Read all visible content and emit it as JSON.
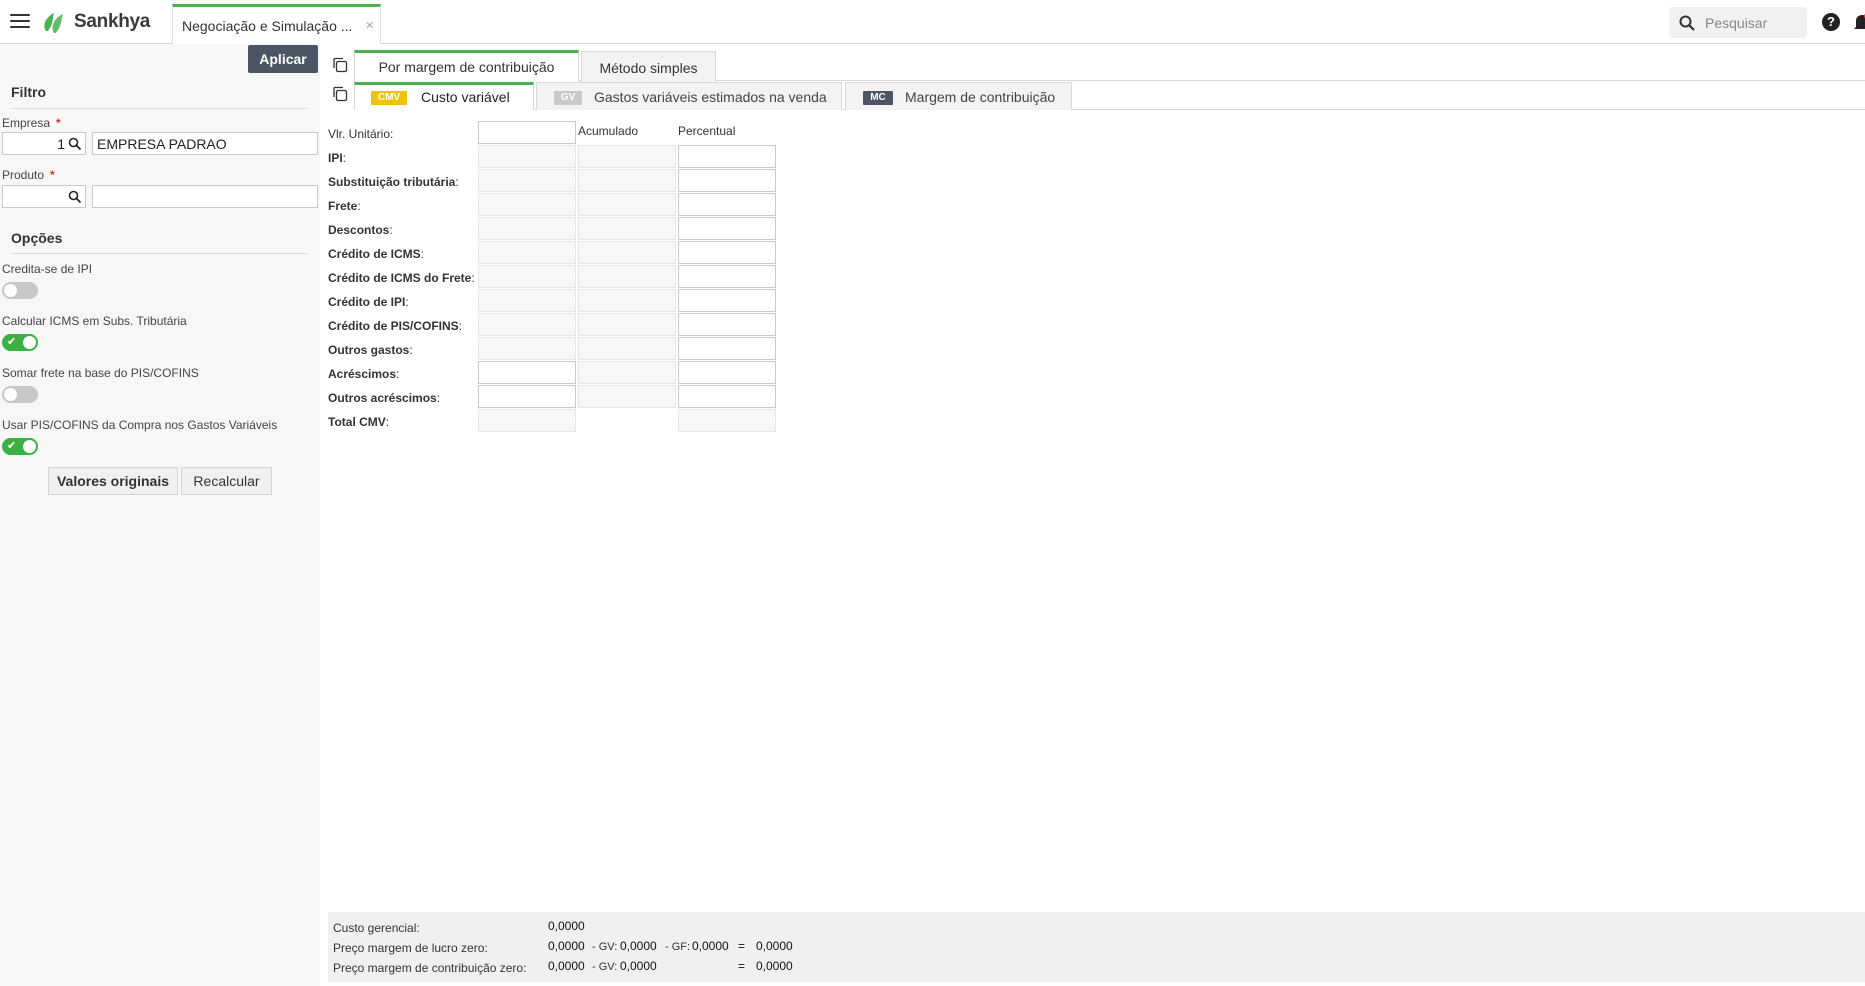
{
  "header": {
    "brand": "Sankhya",
    "open_tab": "Negociação e Simulação ...",
    "close_glyph": "×",
    "search_placeholder": "Pesquisar",
    "help_glyph": "?"
  },
  "filter": {
    "apply_label": "Aplicar",
    "title": "Filtro",
    "empresa_label": "Empresa",
    "empresa_code": "1",
    "empresa_name": "EMPRESA PADRAO",
    "produto_label": "Produto",
    "produto_code": "",
    "produto_name": "",
    "required_mark": "*"
  },
  "options": {
    "title": "Opções",
    "items": [
      {
        "label": "Credita-se de IPI",
        "on": false
      },
      {
        "label": "Calcular ICMS em Subs. Tributária",
        "on": true
      },
      {
        "label": "Somar frete na base do PIS/COFINS",
        "on": false
      },
      {
        "label": "Usar PIS/COFINS da Compra nos Gastos Variáveis",
        "on": true
      }
    ],
    "btn_original": "Valores originais",
    "btn_recalc": "Recalcular"
  },
  "main_tabs": [
    {
      "label": "Por margem de contribuição",
      "active": true
    },
    {
      "label": "Método simples",
      "active": false
    }
  ],
  "sub_tabs": [
    {
      "badge": "CMV",
      "badge_color": "#f2c00f",
      "label": "Custo variável",
      "active": true
    },
    {
      "badge": "GV",
      "badge_color": "#c9c9c9",
      "label": "Gastos variáveis estimados na venda",
      "active": false
    },
    {
      "badge": "MC",
      "badge_color": "#4b5563",
      "label": "Margem de contribuição",
      "active": false
    }
  ],
  "grid": {
    "col_accum": "Acumulado",
    "col_pct": "Percentual",
    "rows": [
      {
        "label": "Vlr. Unitário",
        "bold": false
      },
      {
        "label": "IPI",
        "bold": true
      },
      {
        "label": "Substituição tributária",
        "bold": true
      },
      {
        "label": "Frete",
        "bold": true
      },
      {
        "label": "Descontos",
        "bold": true
      },
      {
        "label": "Crédito de ICMS",
        "bold": true
      },
      {
        "label": "Crédito de ICMS do Frete",
        "bold": true
      },
      {
        "label": "Crédito de IPI",
        "bold": true
      },
      {
        "label": "Crédito de PIS/COFINS",
        "bold": true
      },
      {
        "label": "Outros gastos",
        "bold": true
      },
      {
        "label": "Acréscimos",
        "bold": true
      },
      {
        "label": "Outros acréscimos",
        "bold": true
      },
      {
        "label": "Total CMV",
        "bold": true
      }
    ]
  },
  "footer": {
    "custo_label": "Custo gerencial:",
    "custo_val": "0,0000",
    "plz_label": "Preço margem de lucro zero:",
    "plz_val": "0,0000",
    "plz_gv_prefix": "- GV:",
    "plz_gv": "0,0000",
    "plz_gf_prefix": "- GF:",
    "plz_gf": "0,0000",
    "plz_eq": "=",
    "plz_total": "0,0000",
    "pmc_label": "Preço margem de contribuição zero:",
    "pmc_val": "0,0000",
    "pmc_gv_prefix": "- GV:",
    "pmc_gv": "0,0000",
    "pmc_eq": "=",
    "pmc_total": "0,0000"
  }
}
